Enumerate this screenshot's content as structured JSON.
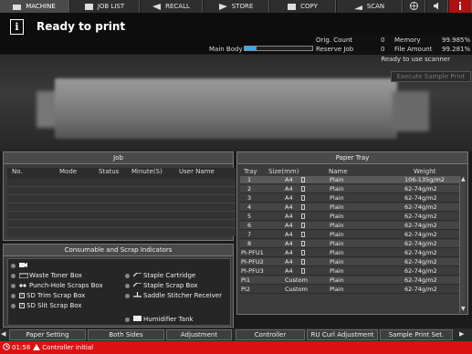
{
  "tabs": [
    {
      "label": "MACHINE",
      "active": true
    },
    {
      "label": "JOB LIST",
      "active": false
    },
    {
      "label": "RECALL",
      "active": false
    },
    {
      "label": "STORE",
      "active": false
    },
    {
      "label": "COPY",
      "active": false
    },
    {
      "label": "SCAN",
      "active": false
    }
  ],
  "header": {
    "title": "Ready to print",
    "main_body_label": "Main Body",
    "main_body_progress": 0.18,
    "orig_count_label": "Orig. Count",
    "orig_count": "0",
    "memory_label": "Memory",
    "memory": "99.985%",
    "reserve_job_label": "Reserve Job",
    "reserve_job": "0",
    "file_amount_label": "File Amount",
    "file_amount": "99.281%",
    "scanner_status": "Ready to use scanner",
    "execute_sample_print": "Execute Sample Print"
  },
  "job_panel": {
    "title": "Job",
    "columns": [
      "No.",
      "Mode",
      "Status",
      "Minute(S)",
      "User Name"
    ]
  },
  "consumables": {
    "title": "Consumable and Scrap Indicators",
    "items_left": [
      "Waste Toner Box",
      "Punch-Hole Scraps Box",
      "SD Trim Scrap Box",
      "SD Slit Scrap Box"
    ],
    "items_right": [
      "Staple Cartridge",
      "Staple Scrap Box",
      "Saddle Stitcher Receiver"
    ],
    "humidifier": "Humidifier Tank"
  },
  "paper_tray": {
    "title": "Paper Tray",
    "columns": [
      "Tray",
      "Size(mm)",
      "Name",
      "Weight"
    ],
    "rows": [
      {
        "tray": "1",
        "size": "A4",
        "name": "Plain",
        "weight": "106-135g/m2"
      },
      {
        "tray": "2",
        "size": "A4",
        "name": "Plain",
        "weight": "62-74g/m2"
      },
      {
        "tray": "3",
        "size": "A4",
        "name": "Plain",
        "weight": "62-74g/m2"
      },
      {
        "tray": "4",
        "size": "A4",
        "name": "Plain",
        "weight": "62-74g/m2"
      },
      {
        "tray": "5",
        "size": "A4",
        "name": "Plain",
        "weight": "62-74g/m2"
      },
      {
        "tray": "6",
        "size": "A4",
        "name": "Plain",
        "weight": "62-74g/m2"
      },
      {
        "tray": "7",
        "size": "A4",
        "name": "Plain",
        "weight": "62-74g/m2"
      },
      {
        "tray": "8",
        "size": "A4",
        "name": "Plain",
        "weight": "62-74g/m2"
      },
      {
        "tray": "PI-PFU1",
        "size": "A4",
        "name": "Plain",
        "weight": "62-74g/m2"
      },
      {
        "tray": "PI-PFU2",
        "size": "A4",
        "name": "Plain",
        "weight": "62-74g/m2"
      },
      {
        "tray": "PI-PFU3",
        "size": "A4",
        "name": "Plain",
        "weight": "62-74g/m2"
      },
      {
        "tray": "PI1",
        "size": "Custom",
        "name": "Plain",
        "weight": "62-74g/m2"
      },
      {
        "tray": "PI2",
        "size": "Custom",
        "name": "Plain",
        "weight": "62-74g/m2"
      }
    ]
  },
  "bottom_buttons": [
    "Paper Setting",
    "Both Sides",
    "Adjustment",
    "Controller",
    "RU Curl Adjustment",
    "Sample Print Set."
  ],
  "status_bar": {
    "time": "01:58",
    "message": "Controller initial"
  },
  "colors": {
    "accent": "#3aa6e8",
    "status_bar": "#dd1111"
  }
}
